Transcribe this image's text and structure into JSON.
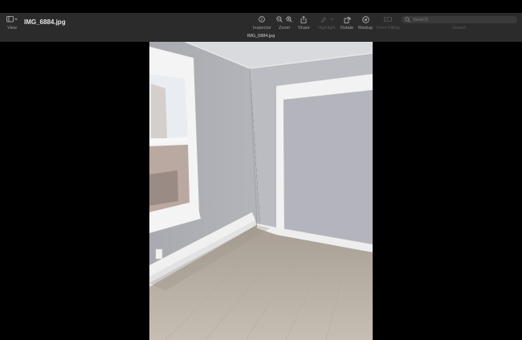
{
  "window": {
    "title": "IMG_6884.jpg",
    "tab_title": "IMG_6884.jpg"
  },
  "toolbar": {
    "view_label": "View",
    "inspector_label": "Inspector",
    "zoom_label": "Zoom",
    "share_label": "Share",
    "highlight_label": "Highlight",
    "rotate_label": "Rotate",
    "markup_label": "Markup",
    "form_filling_label": "Form Filling",
    "search_label": "Search",
    "search_placeholder": "Search"
  },
  "icons": {
    "view": "sidebar-icon",
    "inspector": "info-icon",
    "zoom_out": "zoom-out-icon",
    "zoom_in": "zoom-in-icon",
    "share": "share-icon",
    "highlight": "highlighter-icon",
    "rotate": "rotate-icon",
    "markup": "markup-icon",
    "form_filling": "form-icon",
    "search": "search-icon"
  },
  "colors": {
    "toolbar_bg": "#2b2b2b",
    "canvas_bg": "#000000",
    "wall": "#b9bac0",
    "floor": "#bcb3a6"
  }
}
